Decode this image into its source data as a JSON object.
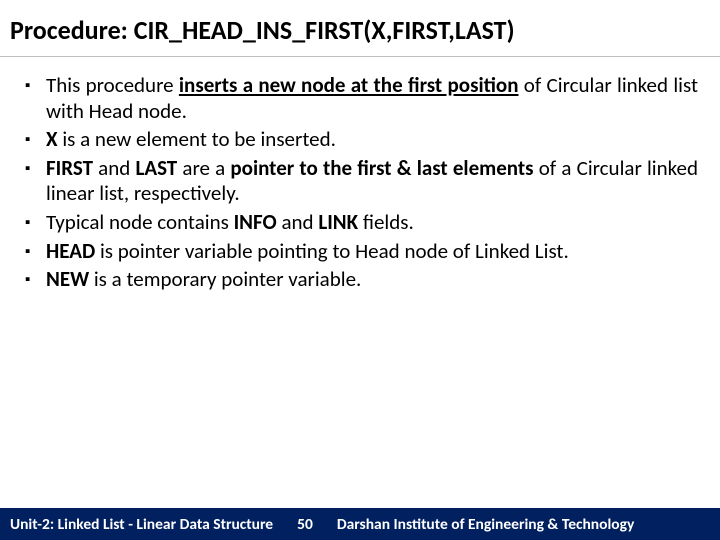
{
  "title": "Procedure: CIR_HEAD_INS_FIRST(X,FIRST,LAST)",
  "bullets": [
    {
      "pre": "This procedure ",
      "strong": "inserts a new node at the first position",
      "post": " of Circular linked list with Head node.",
      "underline_strong": true
    },
    {
      "strong_pre": "X",
      "post": " is a new element to be inserted."
    },
    {
      "strong_pre": "FIRST",
      "mid1": " and ",
      "strong_mid": "LAST",
      "mid2": " are a ",
      "strong2": "pointer to the first & last elements",
      "post": " of a Circular linked linear list, respectively."
    },
    {
      "pre": "Typical node contains ",
      "strong": "INFO",
      "mid": " and ",
      "strong2": "LINK",
      "post": " fields."
    },
    {
      "strong_pre": "HEAD",
      "post": " is pointer variable pointing to Head node of Linked List."
    },
    {
      "strong_pre": "NEW",
      "post": " is a temporary pointer variable."
    }
  ],
  "footer": {
    "unit": "Unit-2: Linked List - Linear Data Structure",
    "page": "50",
    "institute": "Darshan Institute of Engineering & Technology"
  }
}
